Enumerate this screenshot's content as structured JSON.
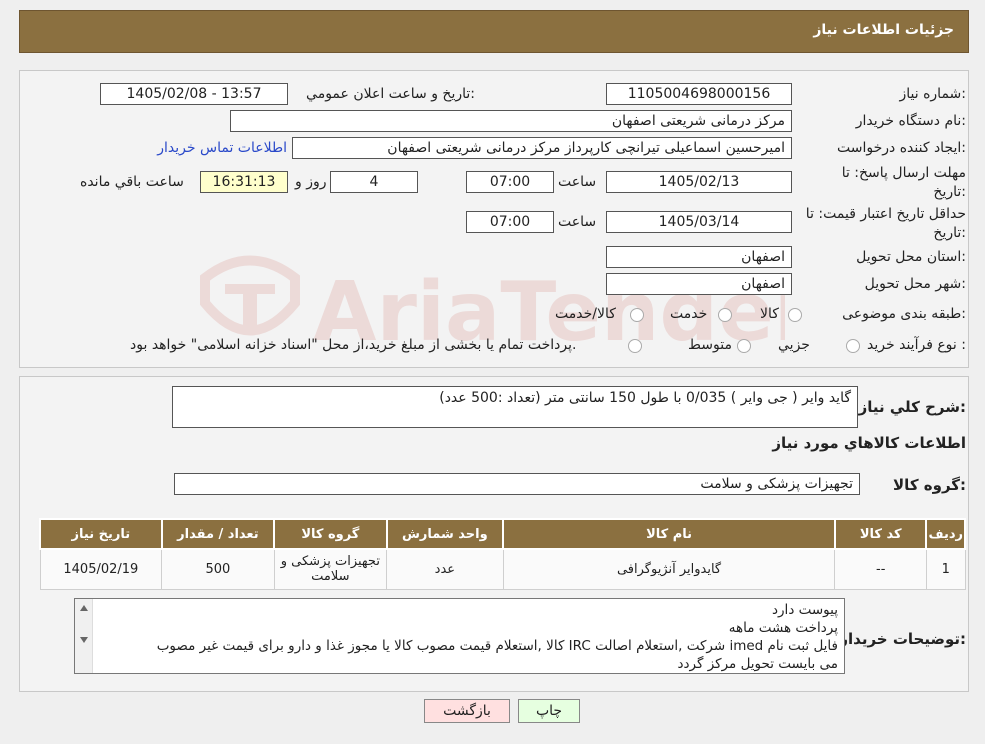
{
  "header": {
    "title": "جزئیات اطلاعات نیاز"
  },
  "form": {
    "need_number_label": "شماره نیاز:",
    "need_number": "1105004698000156",
    "announce_label": "تاریخ و ساعت اعلان عمومي:",
    "announce_value": "1405/02/08 - 13:57",
    "buyer_org_label": "نام دستگاه خريدار:",
    "buyer_org": "مرکز درمانی شریعتی اصفهان",
    "creator_label": "ايجاد کننده درخواست:",
    "creator": "امیرحسین اسماعیلی تیرانچی کارپرداز مرکز درمانی شریعتی اصفهان",
    "contact_link": "اطلاعات تماس خريدار",
    "deadline_label": "مهلت ارسال پاسخ: تا تاريخ:",
    "deadline_date": "1405/02/13",
    "time_label": "ساعت",
    "deadline_time": "07:00",
    "days_value": "4",
    "days_label": "روز و",
    "remaining_time": "16:31:13",
    "remaining_label": "ساعت باقي مانده",
    "validity_label": "حداقل تاريخ اعتبار قيمت: تا تاريخ:",
    "validity_date": "1405/03/14",
    "validity_time": "07:00",
    "province_label": "استان محل تحويل:",
    "province": "اصفهان",
    "city_label": "شهر محل تحويل:",
    "city": "اصفهان",
    "category_label": "طبقه بندی موضوعی:",
    "category_options": [
      "کالا",
      "خدمت",
      "کالا/خدمت"
    ],
    "process_label": "نوع فرآيند خريد :",
    "process_options": [
      "جزيي",
      "متوسط"
    ],
    "process_note": "پرداخت تمام یا بخشی از مبلغ خرید،از محل \"اسناد خزانه اسلامی\" خواهد بود."
  },
  "description": {
    "label": "شرح کلي نياز:",
    "text": "گاید وایر ( جی وایر ) 0/035 با طول 150 سانتی متر (تعداد :500 عدد)"
  },
  "goods_section": {
    "title": "اطلاعات کالاهاي مورد نياز",
    "group_label": "گروه کالا:",
    "group_value": "تجهیزات پزشکی و سلامت"
  },
  "table": {
    "headers": [
      "رديف",
      "کد کالا",
      "نام کالا",
      "واحد شمارش",
      "گروه کالا",
      "تعداد / مقدار",
      "تاريخ نياز"
    ],
    "rows": [
      [
        "1",
        "--",
        "گایدوایر آنژیوگرافی",
        "عدد",
        "تجهیزات پزشکی و سلامت",
        "500",
        "1405/02/19"
      ]
    ]
  },
  "buyer_notes": {
    "label": "توضيحات خريدار:",
    "lines": [
      "پیوست دارد",
      "پرداخت هشت ماهه",
      "فایل ثبت نام imed شرکت ,استعلام اصالت IRC کالا ,استعلام قیمت مصوب کالا یا مجوز غذا و دارو برای قیمت غیر مصوب",
      "می بایست تحویل مرکز گردد"
    ]
  },
  "buttons": {
    "print": "چاپ",
    "back": "بازگشت"
  },
  "watermark": {
    "text": "AriaTender.neT"
  },
  "colors": {
    "header_bg": "#8b7040",
    "link": "#2a49c9",
    "time_bg": "#ffffcc",
    "back_btn_bg": "#ffe0e0",
    "print_btn_bg": "#e6ffe0"
  }
}
